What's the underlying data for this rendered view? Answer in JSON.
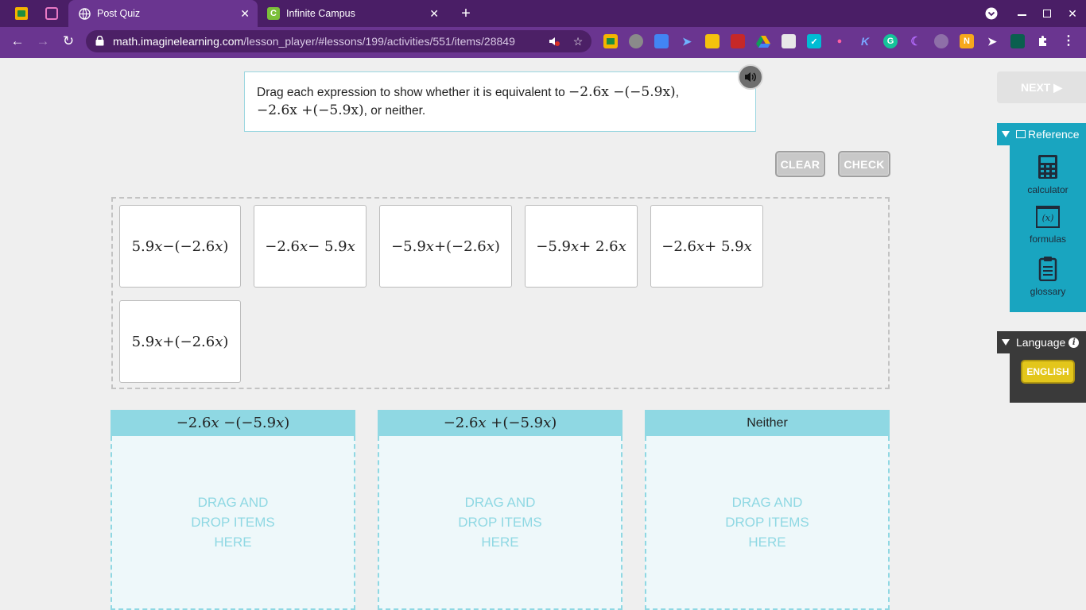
{
  "browser": {
    "tabs": [
      {
        "title": "Post Quiz",
        "active": true
      },
      {
        "title": "Infinite Campus",
        "active": false
      }
    ],
    "url_host": "math.imaginelearning.com",
    "url_path": "/lesson_player/#lessons/199/activities/551/items/28849",
    "colors": {
      "tabbar": "#4a1e66",
      "toolbar": "#6a3590"
    }
  },
  "prompt": {
    "text_before": "Drag each expression to show whether it is equivalent to ",
    "expr1": "−2.6x −(−5.9x)",
    "sep": ", ",
    "expr2": "−2.6x +(−5.9x)",
    "text_after": ", or neither."
  },
  "buttons": {
    "clear": "CLEAR",
    "check": "CHECK",
    "next": "NEXT ▶"
  },
  "cards": [
    {
      "a": "5.9",
      "x1": "x",
      "b": " −(−2.6",
      "x2": "x",
      "c": ")"
    },
    {
      "a": "−2.6",
      "x1": "x",
      "b": " − 5.9",
      "x2": "x",
      "c": ""
    },
    {
      "a": "−5.9",
      "x1": "x",
      "b": " +(−2.6",
      "x2": "x",
      "c": ")"
    },
    {
      "a": "−5.9",
      "x1": "x",
      "b": " + 2.6",
      "x2": "x",
      "c": ""
    },
    {
      "a": "−2.6",
      "x1": "x",
      "b": " + 5.9",
      "x2": "x",
      "c": ""
    },
    {
      "a": "5.9",
      "x1": "x",
      "b": " +(−2.6",
      "x2": "x",
      "c": ")"
    }
  ],
  "bins": [
    {
      "a": "−2.6",
      "x1": "x",
      "b": " −(−5.9",
      "x2": "x",
      "c": ")",
      "placeholder_l1": "DRAG AND",
      "placeholder_l2": "DROP ITEMS",
      "placeholder_l3": "HERE"
    },
    {
      "a": "−2.6",
      "x1": "x",
      "b": " +(−5.9",
      "x2": "x",
      "c": ")",
      "placeholder_l1": "DRAG AND",
      "placeholder_l2": "DROP ITEMS",
      "placeholder_l3": "HERE"
    },
    {
      "label": "Neither",
      "placeholder_l1": "DRAG AND",
      "placeholder_l2": "DROP ITEMS",
      "placeholder_l3": "HERE"
    }
  ],
  "reference": {
    "title": "Reference",
    "tools": [
      "calculator",
      "formulas",
      "glossary"
    ],
    "formulas_glyph": "(x)"
  },
  "language": {
    "title": "Language",
    "info": "i",
    "current": "ENGLISH"
  },
  "colors": {
    "accent": "#19a5c0",
    "bin_header": "#8fd8e3",
    "english": "#e3c61b"
  }
}
